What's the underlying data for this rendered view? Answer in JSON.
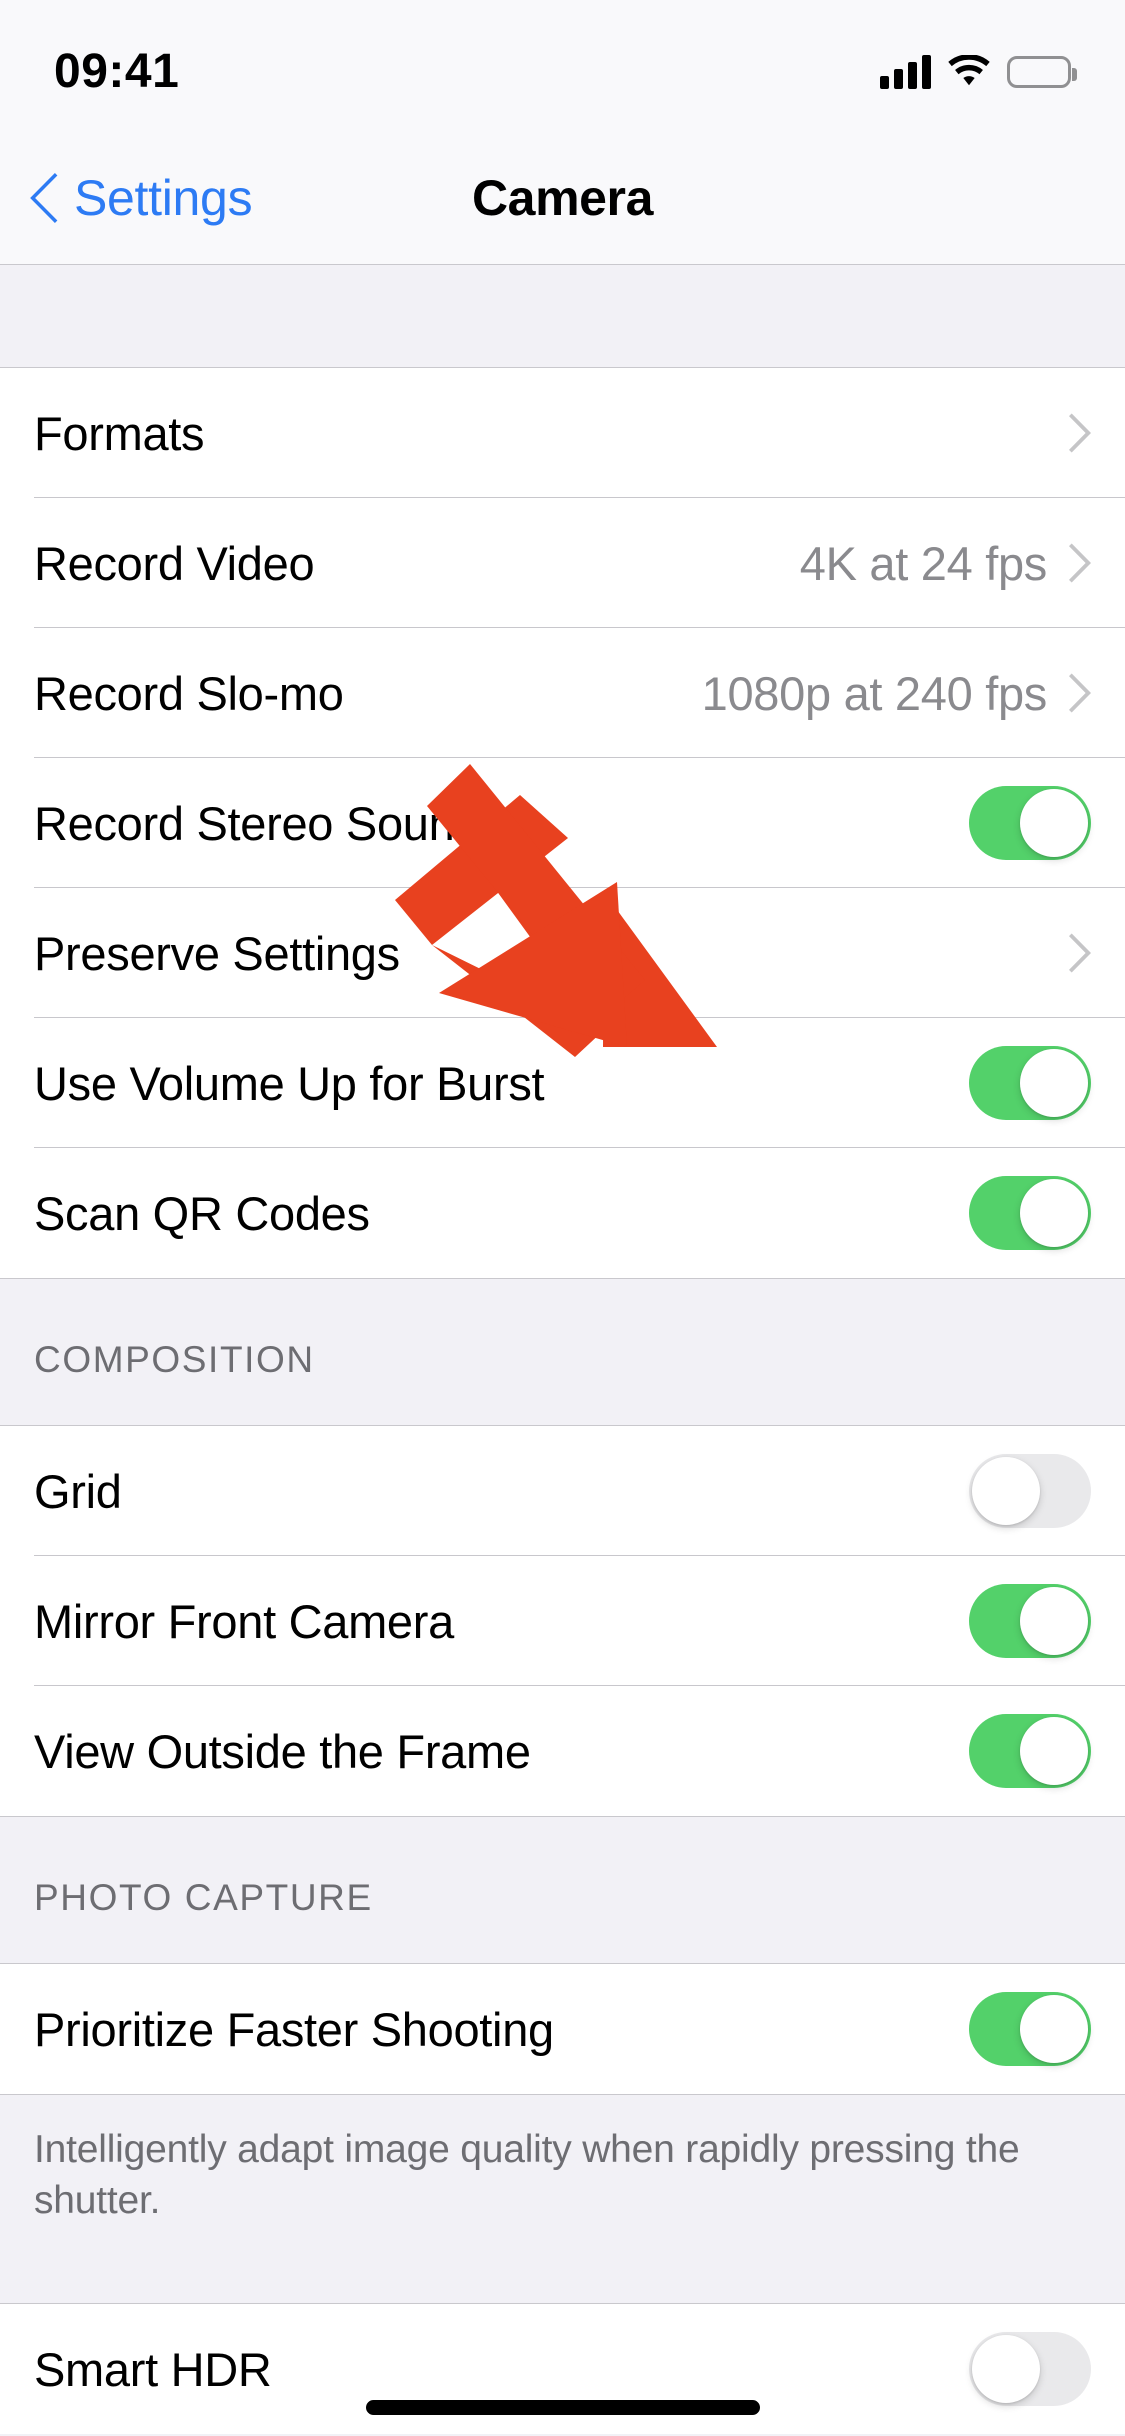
{
  "status_bar": {
    "time": "09:41",
    "cellular_icon": "cellular-bars-icon",
    "wifi_icon": "wifi-icon",
    "battery_icon": "battery-full-icon"
  },
  "nav_bar": {
    "back_label": "Settings",
    "back_icon": "chevron-left-icon",
    "title": "Camera"
  },
  "colors": {
    "accent_blue": "#2D7BF4",
    "toggle_on_green": "#53D16A",
    "toggle_off_gray": "#E9E9EB",
    "annotation_red": "#E8411F",
    "group_background": "#FFFFFF",
    "page_background": "#F2F1F6",
    "secondary_text": "#8A8A8E",
    "header_text": "#6D6D72"
  },
  "sections": [
    {
      "header": "",
      "rows": [
        {
          "label": "Formats",
          "type": "disclosure",
          "value": ""
        },
        {
          "label": "Record Video",
          "type": "disclosure",
          "value": "4K at 24 fps"
        },
        {
          "label": "Record Slo-mo",
          "type": "disclosure",
          "value": "1080p at 240 fps"
        },
        {
          "label": "Record Stereo Sound",
          "type": "toggle",
          "state": "on"
        },
        {
          "label": "Preserve Settings",
          "type": "disclosure",
          "value": ""
        },
        {
          "label": "Use Volume Up for Burst",
          "type": "toggle",
          "state": "on"
        },
        {
          "label": "Scan QR Codes",
          "type": "toggle",
          "state": "on"
        }
      ]
    },
    {
      "header": "COMPOSITION",
      "rows": [
        {
          "label": "Grid",
          "type": "toggle",
          "state": "off"
        },
        {
          "label": "Mirror Front Camera",
          "type": "toggle",
          "state": "on"
        },
        {
          "label": "View Outside the Frame",
          "type": "toggle",
          "state": "on"
        }
      ]
    },
    {
      "header": "PHOTO CAPTURE",
      "rows": [
        {
          "label": "Prioritize Faster Shooting",
          "type": "toggle",
          "state": "on"
        }
      ],
      "footer": "Intelligently adapt image quality when rapidly pressing the shutter."
    },
    {
      "header": "",
      "rows": [
        {
          "label": "Smart HDR",
          "type": "toggle",
          "state": "off"
        }
      ]
    }
  ],
  "annotation": {
    "type": "arrow",
    "color": "#E8411F",
    "points_to": "Use Volume Up for Burst toggle"
  },
  "home_indicator": "home-indicator-bar"
}
